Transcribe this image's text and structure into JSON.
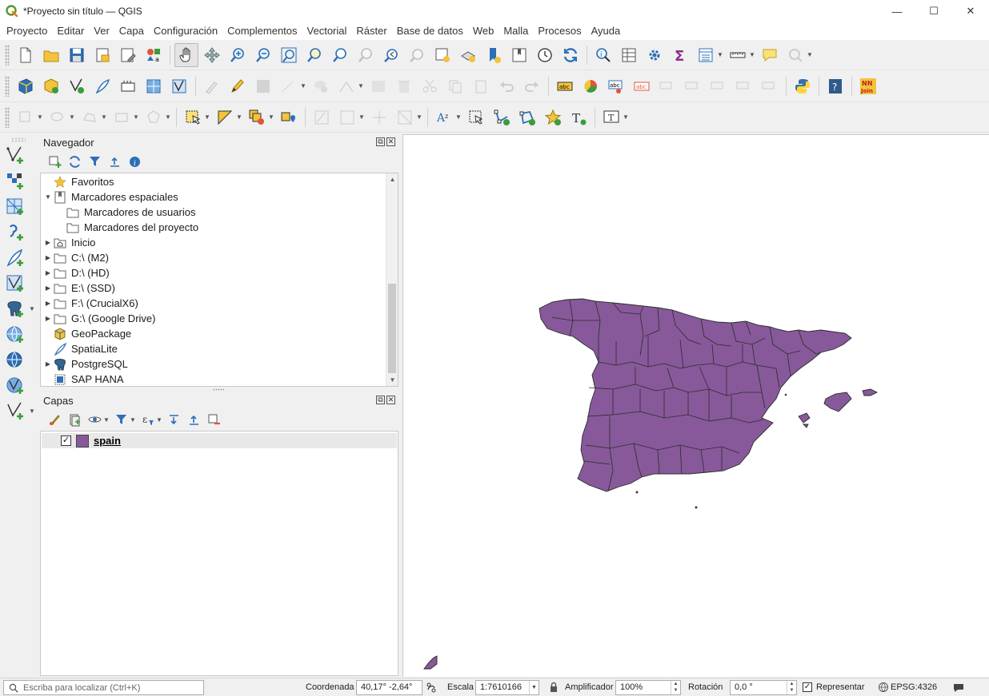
{
  "window": {
    "title": "*Proyecto sin título — QGIS",
    "minimize": "—",
    "maximize": "☐",
    "close": "✕"
  },
  "menubar": [
    "Proyecto",
    "Editar",
    "Ver",
    "Capa",
    "Configuración",
    "Complementos",
    "Vectorial",
    "Ráster",
    "Base de datos",
    "Web",
    "Malla",
    "Procesos",
    "Ayuda"
  ],
  "navigator": {
    "title": "Navegador",
    "items": [
      {
        "label": "Favoritos",
        "icon": "star-icon",
        "expander": ""
      },
      {
        "label": "Marcadores espaciales",
        "icon": "bookmark-icon",
        "expander": "▼"
      },
      {
        "label": "Marcadores de usuarios",
        "icon": "folder-icon",
        "expander": ""
      },
      {
        "label": "Marcadores del proyecto",
        "icon": "folder-icon",
        "expander": ""
      },
      {
        "label": "Inicio",
        "icon": "home-folder-icon",
        "expander": "▶"
      },
      {
        "label": "C:\\ (M2)",
        "icon": "folder-icon",
        "expander": "▶"
      },
      {
        "label": "D:\\ (HD)",
        "icon": "folder-icon",
        "expander": "▶"
      },
      {
        "label": "E:\\ (SSD)",
        "icon": "folder-icon",
        "expander": "▶"
      },
      {
        "label": "F:\\ (CrucialX6)",
        "icon": "folder-icon",
        "expander": "▶"
      },
      {
        "label": "G:\\ (Google Drive)",
        "icon": "folder-icon",
        "expander": "▶"
      },
      {
        "label": "GeoPackage",
        "icon": "geopackage-icon",
        "expander": ""
      },
      {
        "label": "SpatiaLite",
        "icon": "spatialite-icon",
        "expander": ""
      },
      {
        "label": "PostgreSQL",
        "icon": "postgresql-icon",
        "expander": "▶"
      },
      {
        "label": "SAP HANA",
        "icon": "sap-hana-icon",
        "expander": ""
      }
    ]
  },
  "layers_panel": {
    "title": "Capas",
    "layers": [
      {
        "name": "spain",
        "checked": "✓",
        "color": "#87599a"
      }
    ]
  },
  "map": {
    "fill": "#87599a",
    "stroke": "#2b2b2b"
  },
  "statusbar": {
    "locator_placeholder": "Escriba para localizar (Ctrl+K)",
    "coord_label": "Coordenada",
    "coord_value": "40,17° -2,64°",
    "scale_label": "Escala",
    "scale_value": "1:7610166",
    "magnifier_label": "Amplificador",
    "magnifier_value": "100%",
    "rotation_label": "Rotación",
    "rotation_value": "0,0 °",
    "render_label": "Representar",
    "render_checked": "✓",
    "crs": "EPSG:4326"
  },
  "icons": {
    "accent_green": "#3a9d3a",
    "accent_blue": "#2c6fb7",
    "accent_yellow": "#f3c33b"
  }
}
